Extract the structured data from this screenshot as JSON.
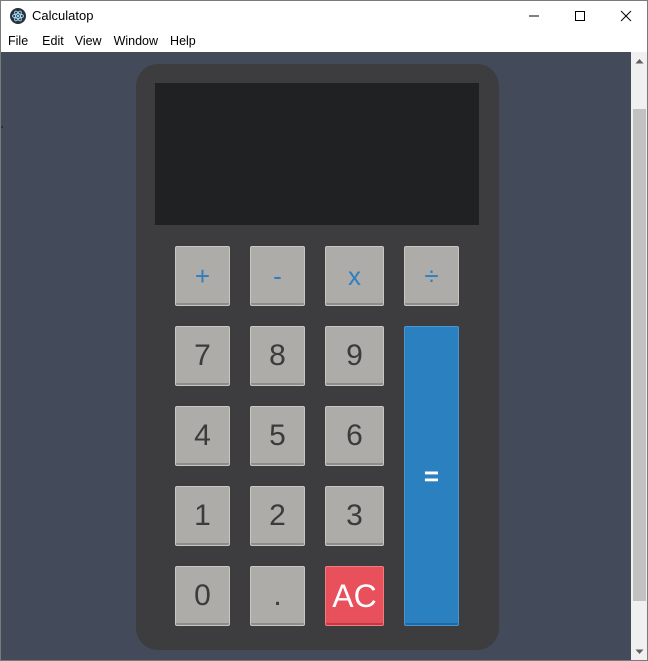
{
  "window": {
    "title": "Calculatop",
    "controls": {
      "minimize_icon": "minimize-icon",
      "maximize_icon": "maximize-icon",
      "close_icon": "close-icon"
    }
  },
  "menu": {
    "items": [
      "File",
      "Edit",
      "View",
      "Window",
      "Help"
    ]
  },
  "calculator": {
    "display_value": "",
    "operators": {
      "add": "+",
      "subtract": "-",
      "multiply": "x",
      "divide": "÷"
    },
    "digits": {
      "d7": "7",
      "d8": "8",
      "d9": "9",
      "d4": "4",
      "d5": "5",
      "d6": "6",
      "d1": "1",
      "d2": "2",
      "d3": "3",
      "d0": "0",
      "dot": "."
    },
    "clear_label": "AC",
    "equals_label": "="
  },
  "colors": {
    "background": "#434a59",
    "calculator_body": "#3d3d3f",
    "display": "#202123",
    "key": "#aeaca9",
    "operator_text": "#2c7fc0",
    "clear_key": "#e8505b",
    "equals_key": "#2b80c0"
  }
}
